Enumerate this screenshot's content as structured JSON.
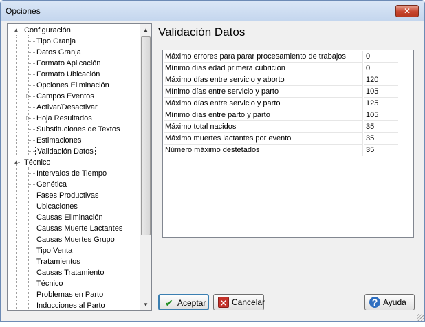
{
  "window": {
    "title": "Opciones",
    "close_label": "✕"
  },
  "tree": {
    "root1": {
      "label": "Configuración",
      "expander": "▲"
    },
    "config_items": [
      {
        "label": "Tipo Granja"
      },
      {
        "label": "Datos Granja"
      },
      {
        "label": "Formato Aplicación"
      },
      {
        "label": "Formato Ubicación"
      },
      {
        "label": "Opciones Eliminación"
      },
      {
        "label": "Campos Eventos",
        "expander": "▷"
      },
      {
        "label": "Activar/Desactivar"
      },
      {
        "label": "Hoja Resultados",
        "expander": "▷"
      },
      {
        "label": "Substituciones de Textos"
      },
      {
        "label": "Estimaciones"
      },
      {
        "label": "Validación Datos",
        "selected": true
      }
    ],
    "root2": {
      "label": "Técnico",
      "expander": "▲"
    },
    "tecnico_items": [
      {
        "label": "Intervalos de Tiempo"
      },
      {
        "label": "Genética"
      },
      {
        "label": "Fases Productivas"
      },
      {
        "label": "Ubicaciones"
      },
      {
        "label": "Causas Eliminación"
      },
      {
        "label": "Causas Muerte Lactantes"
      },
      {
        "label": "Causas Muertes Grupo"
      },
      {
        "label": "Tipo Venta"
      },
      {
        "label": "Tratamientos"
      },
      {
        "label": "Causas Tratamiento"
      },
      {
        "label": "Técnico"
      },
      {
        "label": "Problemas en Parto"
      },
      {
        "label": "Inducciones al Parto"
      }
    ],
    "scroll": {
      "up": "▲",
      "down": "▼",
      "grip": "≡"
    }
  },
  "panel": {
    "heading": "Validación Datos",
    "rows": [
      {
        "label": "Máximo errores para parar procesamiento de trabajos",
        "value": "0"
      },
      {
        "label": "Mínimo días edad primera cubrición",
        "value": "0"
      },
      {
        "label": "Máximo días entre servicio y aborto",
        "value": "120"
      },
      {
        "label": "Mínimo días entre servicio y parto",
        "value": "105"
      },
      {
        "label": "Máximo días entre servicio y parto",
        "value": "125"
      },
      {
        "label": "Mínimo días entre parto y parto",
        "value": "105"
      },
      {
        "label": "Máximo total nacidos",
        "value": "35"
      },
      {
        "label": "Máximo muertes lactantes por evento",
        "value": "35"
      },
      {
        "label": "Número máximo destetados",
        "value": "35"
      }
    ]
  },
  "buttons": {
    "accept": {
      "label": "Aceptar",
      "icon": "check-icon"
    },
    "cancel": {
      "label": "Cancelar",
      "icon": "x-icon"
    },
    "help": {
      "label": "Ayuda",
      "icon": "question-icon"
    }
  },
  "colors": {
    "accept_border": "#3c7fb1",
    "close_red": "#c7462f"
  }
}
